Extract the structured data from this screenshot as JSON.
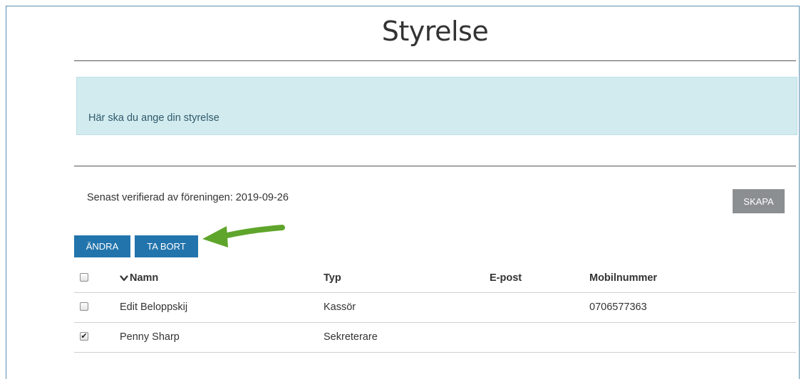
{
  "page": {
    "title": "Styrelse",
    "info_text": "Här ska du ange din styrelse",
    "verified_text": "Senast verifierad av föreningen: 2019-09-26"
  },
  "toolbar": {
    "create_label": "SKAPA",
    "edit_label": "ÄNDRA",
    "delete_label": "TA BORT"
  },
  "colors": {
    "primary_button": "#2274ac",
    "secondary_button": "#8c8f92",
    "info_background": "#d1ebef",
    "arrow": "#5fa52b"
  },
  "table": {
    "sort_icon": "chevron-down-icon",
    "columns": [
      "Namn",
      "Typ",
      "E-post",
      "Mobilnummer"
    ],
    "rows": [
      {
        "checked": false,
        "name": "Edit Beloppskij",
        "type": "Kassör",
        "email": "",
        "mobile": "0706577363"
      },
      {
        "checked": true,
        "name": "Penny Sharp",
        "type": "Sekreterare",
        "email": "",
        "mobile": ""
      }
    ]
  }
}
